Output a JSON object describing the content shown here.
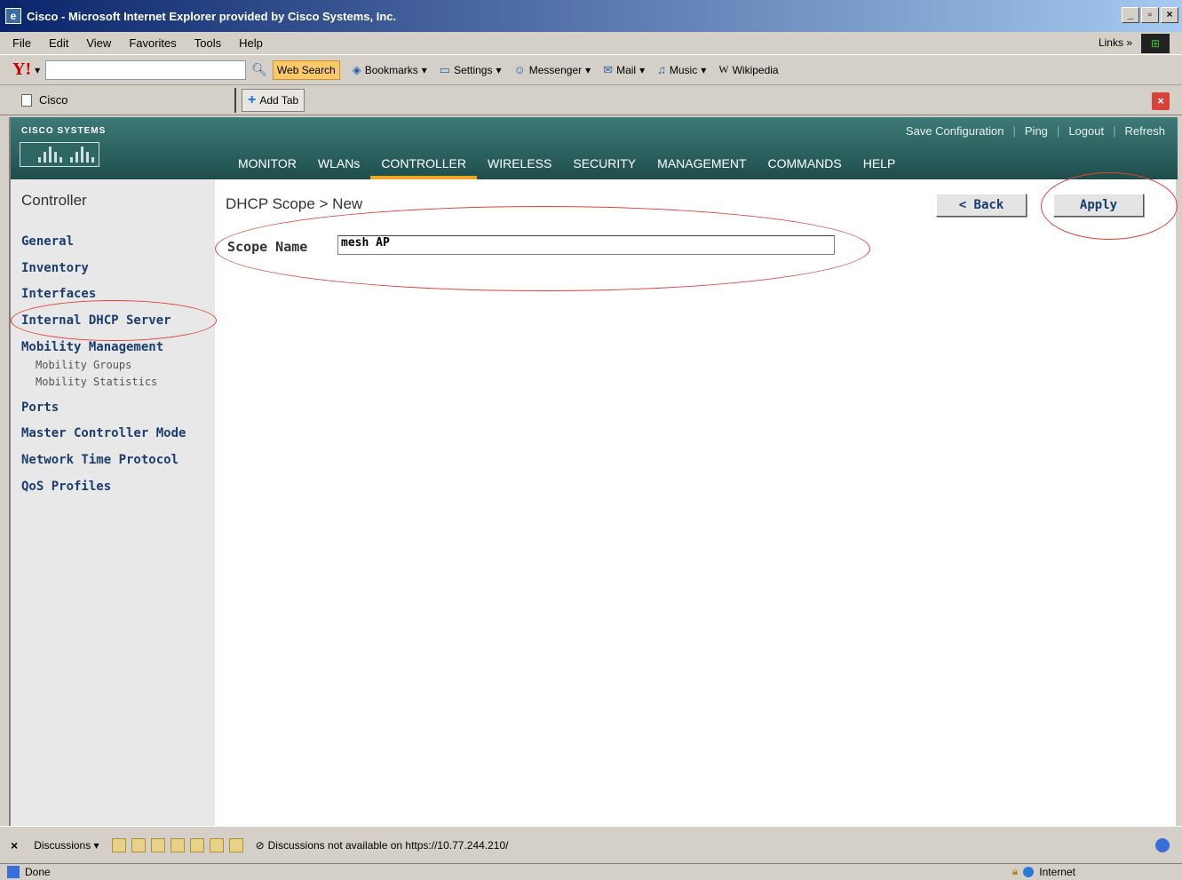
{
  "window": {
    "title": "Cisco - Microsoft Internet Explorer provided by Cisco Systems, Inc.",
    "controls": [
      "_",
      "̱",
      "×"
    ]
  },
  "menubar": {
    "items": [
      "File",
      "Edit",
      "View",
      "Favorites",
      "Tools",
      "Help"
    ],
    "links": "Links »"
  },
  "yahoo_toolbar": {
    "logo": "Y!",
    "search_value": "",
    "web_search": "Web Search",
    "bookmarks": "Bookmarks",
    "settings": "Settings",
    "messenger": "Messenger",
    "mail": "Mail",
    "music": "Music",
    "wikipedia": "Wikipedia"
  },
  "tabs": {
    "current": "Cisco",
    "add_tab": "Add Tab"
  },
  "cisco": {
    "logo_text": "CISCO SYSTEMS",
    "top_links": [
      "Save Configuration",
      "Ping",
      "Logout",
      "Refresh"
    ],
    "nav": [
      "MONITOR",
      "WLANs",
      "CONTROLLER",
      "WIRELESS",
      "SECURITY",
      "MANAGEMENT",
      "COMMANDS",
      "HELP"
    ],
    "active_nav": "CONTROLLER"
  },
  "leftnav": {
    "heading": "Controller",
    "items": [
      "General",
      "Inventory",
      "Interfaces",
      "Internal DHCP Server",
      "Mobility Management",
      "Ports",
      "Master Controller Mode",
      "Network Time Protocol",
      "QoS Profiles"
    ],
    "subitems": [
      "Mobility Groups",
      "Mobility Statistics"
    ]
  },
  "main": {
    "title": "DHCP Scope > New",
    "scope_label": "Scope Name",
    "scope_value": "mesh AP",
    "back_label": "< Back",
    "apply_label": "Apply"
  },
  "discussions": {
    "close": "×",
    "label": "Discussions ▾",
    "message": "Discussions not available on https://10.77.244.210/"
  },
  "status": {
    "text": "Done",
    "zone": "Internet"
  }
}
